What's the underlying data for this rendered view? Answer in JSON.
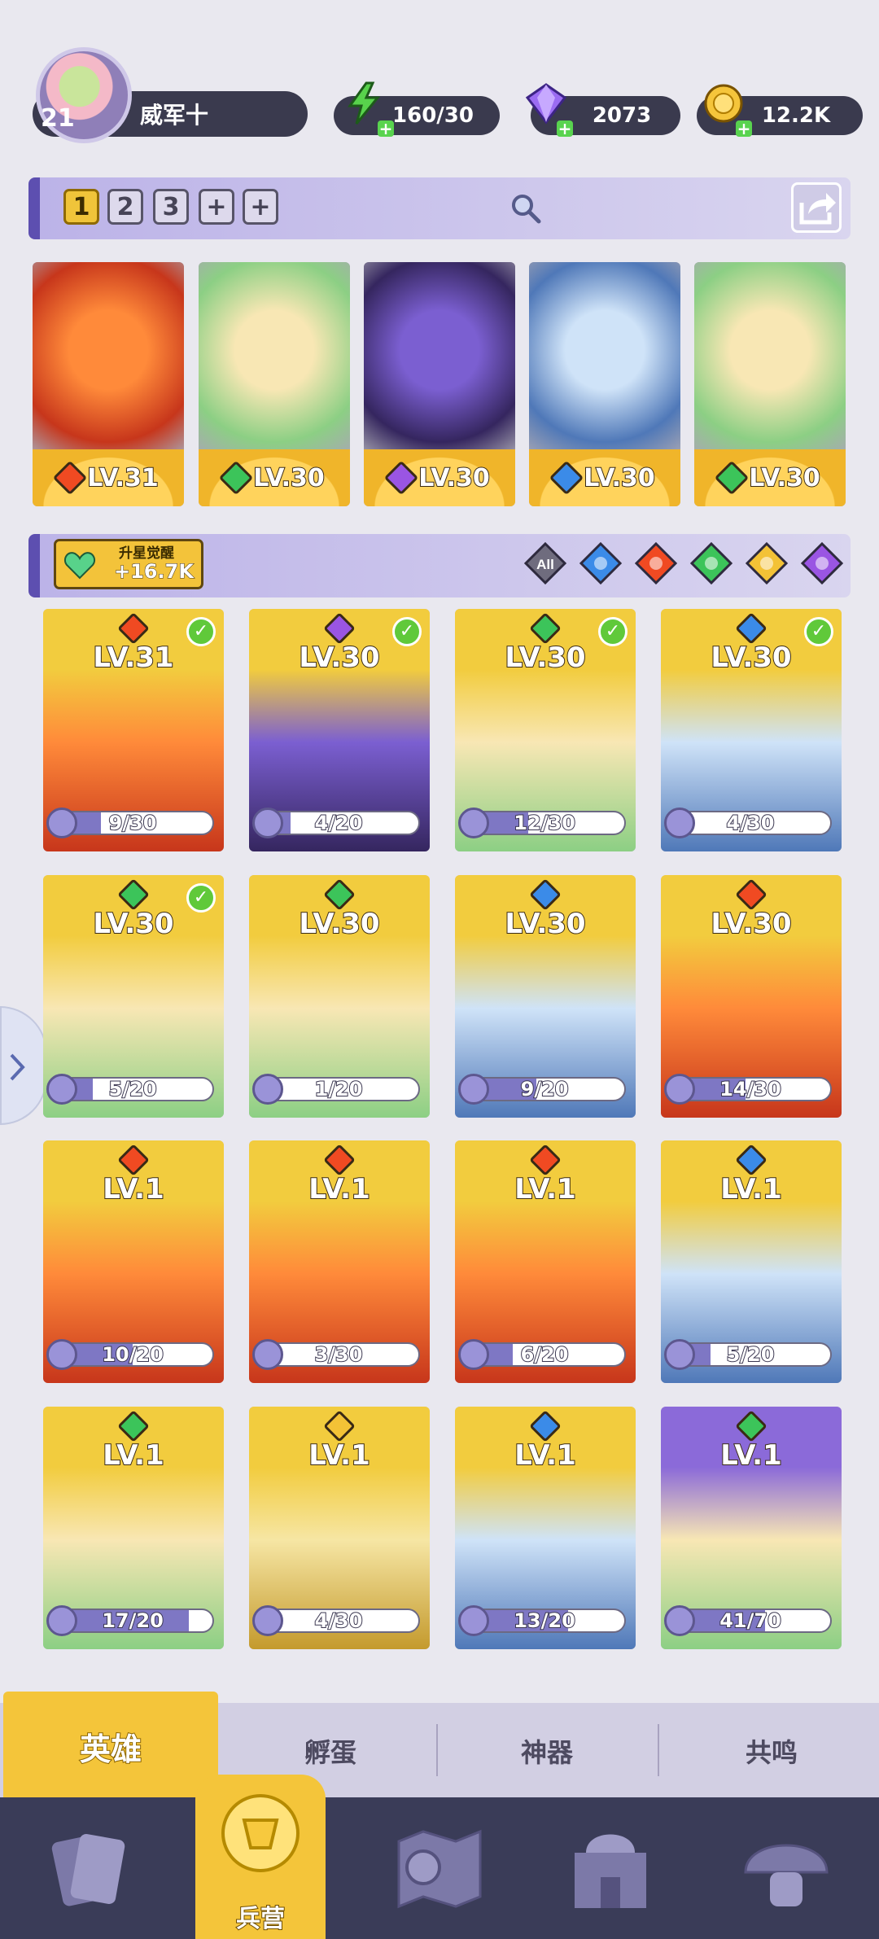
{
  "player": {
    "level": "21",
    "name": "威军十",
    "avatar": "avatar-portrait"
  },
  "resources": [
    {
      "icon": "energy-icon",
      "value": "160/30"
    },
    {
      "icon": "gem-icon",
      "value": "2073"
    },
    {
      "icon": "coin-icon",
      "value": "12.2K"
    }
  ],
  "team_tabs": [
    "1",
    "2",
    "3",
    "+",
    "+"
  ],
  "team_heroes": [
    {
      "element": "fire",
      "level": "LV.31"
    },
    {
      "element": "wind",
      "level": "LV.30"
    },
    {
      "element": "dark",
      "level": "LV.30"
    },
    {
      "element": "water",
      "level": "LV.30"
    },
    {
      "element": "wind",
      "level": "LV.30"
    }
  ],
  "awaken": {
    "label": "升星觉醒",
    "value": "+16.7K"
  },
  "filters": [
    {
      "icon": "all-filter-icon",
      "label": "All"
    },
    {
      "icon": "water-element-icon"
    },
    {
      "icon": "fire-element-icon"
    },
    {
      "icon": "wind-element-icon"
    },
    {
      "icon": "light-element-icon"
    },
    {
      "icon": "dark-element-icon"
    }
  ],
  "heroes": [
    {
      "element": "fire",
      "level": "LV.31",
      "fragments": "9/30",
      "progress": 0.3,
      "checked": true,
      "bg": "gold"
    },
    {
      "element": "dark",
      "level": "LV.30",
      "fragments": "4/20",
      "progress": 0.2,
      "checked": true,
      "bg": "gold"
    },
    {
      "element": "wind",
      "level": "LV.30",
      "fragments": "12/30",
      "progress": 0.4,
      "checked": true,
      "bg": "gold"
    },
    {
      "element": "water",
      "level": "LV.30",
      "fragments": "4/30",
      "progress": 0.13,
      "checked": true,
      "bg": "gold"
    },
    {
      "element": "wind",
      "level": "LV.30",
      "fragments": "5/20",
      "progress": 0.25,
      "checked": true,
      "bg": "gold"
    },
    {
      "element": "wind",
      "level": "LV.30",
      "fragments": "1/20",
      "progress": 0.05,
      "checked": false,
      "bg": "gold"
    },
    {
      "element": "water",
      "level": "LV.30",
      "fragments": "9/20",
      "progress": 0.45,
      "checked": false,
      "bg": "gold"
    },
    {
      "element": "fire",
      "level": "LV.30",
      "fragments": "14/30",
      "progress": 0.47,
      "checked": false,
      "bg": "gold"
    },
    {
      "element": "fire",
      "level": "LV.1",
      "fragments": "10/20",
      "progress": 0.5,
      "checked": false,
      "bg": "gold"
    },
    {
      "element": "fire",
      "level": "LV.1",
      "fragments": "3/30",
      "progress": 0.1,
      "checked": false,
      "bg": "gold"
    },
    {
      "element": "fire",
      "level": "LV.1",
      "fragments": "6/20",
      "progress": 0.3,
      "checked": false,
      "bg": "gold"
    },
    {
      "element": "water",
      "level": "LV.1",
      "fragments": "5/20",
      "progress": 0.25,
      "checked": false,
      "bg": "gold"
    },
    {
      "element": "wind",
      "level": "LV.1",
      "fragments": "17/20",
      "progress": 0.85,
      "checked": false,
      "bg": "gold"
    },
    {
      "element": "light",
      "level": "LV.1",
      "fragments": "4/30",
      "progress": 0.13,
      "checked": false,
      "bg": "gold"
    },
    {
      "element": "water",
      "level": "LV.1",
      "fragments": "13/20",
      "progress": 0.65,
      "checked": false,
      "bg": "gold"
    },
    {
      "element": "wind",
      "level": "LV.1",
      "fragments": "41/70",
      "progress": 0.59,
      "checked": false,
      "bg": "purple"
    }
  ],
  "sub_tabs": [
    "英雄",
    "孵蛋",
    "神器",
    "共鸣"
  ],
  "bottom_nav": [
    {
      "icon": "cards-icon"
    },
    {
      "icon": "barracks-icon",
      "label": "兵营"
    },
    {
      "icon": "map-icon"
    },
    {
      "icon": "castle-icon"
    },
    {
      "icon": "mushroom-icon"
    }
  ],
  "colors": {
    "accent": "#f4c53a",
    "panel": "#3a3a4e",
    "bar": "#5d4fb0"
  }
}
